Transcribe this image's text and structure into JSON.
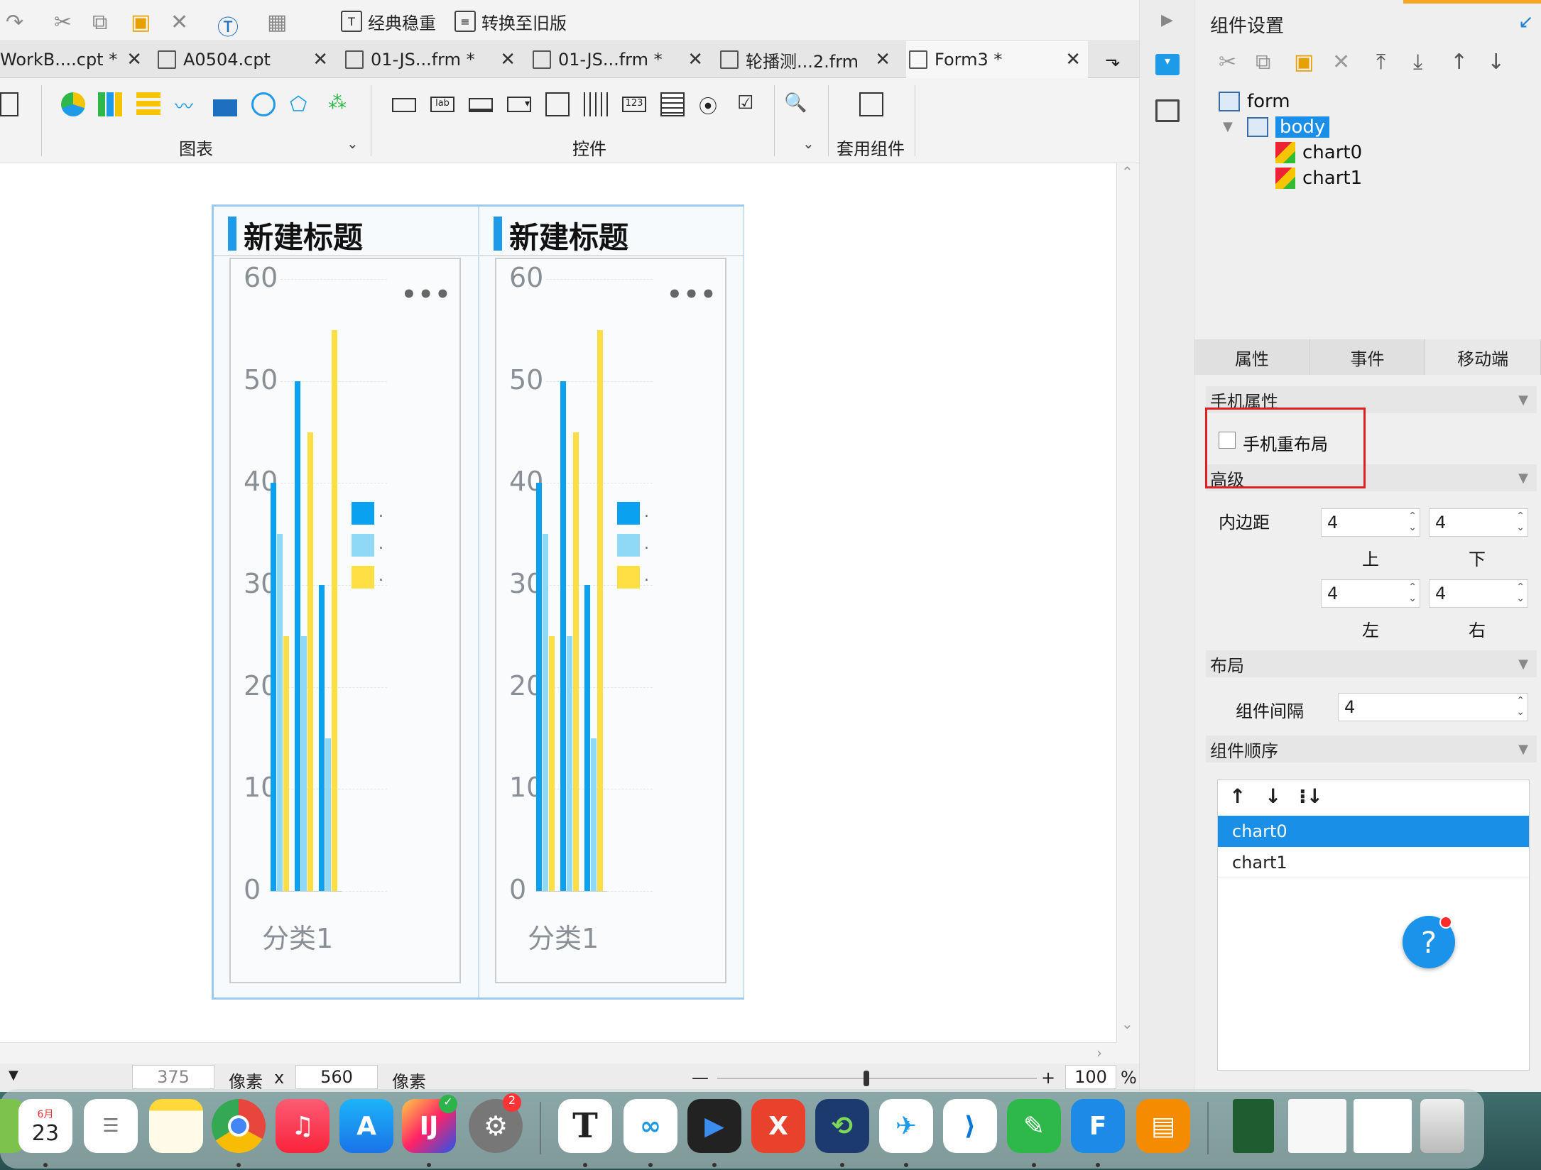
{
  "toolbar": {
    "classic_label": "经典稳重",
    "convert_label": "转换至旧版"
  },
  "tabs": [
    {
      "label": "WorkB....cpt *"
    },
    {
      "label": "A0504.cpt"
    },
    {
      "label": "01-JS...frm *"
    },
    {
      "label": "01-JS...frm *"
    },
    {
      "label": "轮播测...2.frm"
    },
    {
      "label": "Form3  *"
    }
  ],
  "ribbon": {
    "chart_group": "图表",
    "widget_group": "控件",
    "preset_group": "套用组件",
    "widget_lab": "lab",
    "widget_123": "123"
  },
  "colors": {
    "accent": "#1e9be8",
    "series1": "#0aa2f0",
    "series2": "#8fd8f6",
    "series3": "#ffdf44",
    "selection": "#1a8fe8"
  },
  "form": {
    "panels": [
      {
        "title": "新建标题",
        "legend": [
          ".",
          ".",
          "."
        ],
        "category": "分类1"
      },
      {
        "title": "新建标题",
        "legend": [
          ".",
          ".",
          "."
        ],
        "category": "分类1"
      }
    ]
  },
  "chart_data": [
    {
      "type": "bar",
      "categories": [
        "分类1"
      ],
      "yticks": [
        "60",
        "50",
        "40",
        "30",
        "20",
        "10",
        "0"
      ],
      "ylim": [
        0,
        60
      ],
      "series": [
        {
          "values": [
            40,
            50,
            30
          ]
        },
        {
          "values": [
            35,
            25,
            15
          ]
        },
        {
          "values": [
            25,
            45,
            55
          ]
        }
      ]
    },
    {
      "type": "bar",
      "categories": [
        "分类1"
      ],
      "yticks": [
        "60",
        "50",
        "40",
        "30",
        "20",
        "10",
        "0"
      ],
      "ylim": [
        0,
        60
      ],
      "series": [
        {
          "values": [
            40,
            50,
            30
          ]
        },
        {
          "values": [
            35,
            25,
            15
          ]
        },
        {
          "values": [
            25,
            45,
            55
          ]
        }
      ]
    }
  ],
  "status": {
    "width": "375",
    "unit1": "像素",
    "x": "x",
    "height": "560",
    "unit2": "像素",
    "zoom_minus": "—",
    "zoom_plus": "+",
    "zoom": "100",
    "pct": "%"
  },
  "right": {
    "header": "组件设置",
    "tree": {
      "root": "form",
      "body": "body",
      "children": [
        "chart0",
        "chart1"
      ]
    },
    "tabs": [
      "属性",
      "事件",
      "移动端"
    ],
    "mobile_props": "手机属性",
    "mobile_relayout": "手机重布局",
    "advanced": "高级",
    "padding_label": "内边距",
    "padding": {
      "top": "4",
      "bottom": "4",
      "left": "4",
      "right": "4"
    },
    "pad_top_lbl": "上",
    "pad_bottom_lbl": "下",
    "pad_left_lbl": "左",
    "pad_right_lbl": "右",
    "layout": "布局",
    "gap_label": "组件间隔",
    "gap": "4",
    "order": "组件顺序",
    "order_items": [
      "chart0",
      "chart1"
    ],
    "help": "?"
  },
  "dock": {
    "calendar_month": "6月",
    "calendar_day": "23",
    "badge_count": "2",
    "text_app": "T"
  }
}
